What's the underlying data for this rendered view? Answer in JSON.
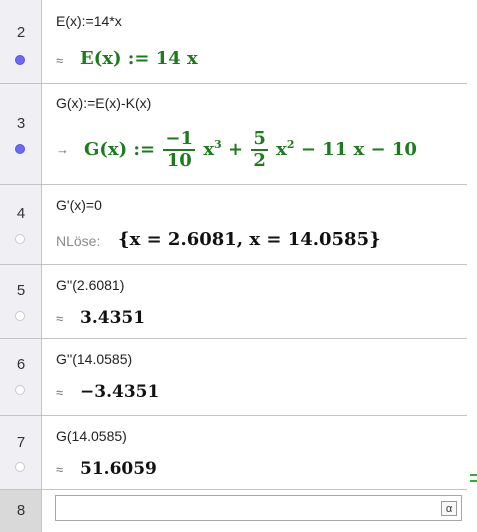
{
  "rows": [
    {
      "num": "2",
      "input": "E(x):=14*x",
      "symbol": "≈",
      "output": "E(x) := 14 x"
    },
    {
      "num": "3",
      "input": "G(x):=E(x)-K(x)",
      "symbol": "→",
      "output": {
        "lhs": "G(x) :=",
        "f1_num": "−1",
        "f1_den": "10",
        "x3": "x",
        "exp3": "3",
        "plus": "+",
        "f2_num": "5",
        "f2_den": "2",
        "x2": "x",
        "exp2": "2",
        "rest": "− 11 x − 10"
      }
    },
    {
      "num": "4",
      "input": "G'(x)=0",
      "symbol": "NLöse:",
      "output": "{x = 2.6081, x = 14.0585}"
    },
    {
      "num": "5",
      "input": "G''(2.6081)",
      "symbol": "≈",
      "output": "3.4351"
    },
    {
      "num": "6",
      "input": "G''(14.0585)",
      "symbol": "≈",
      "output": "−3.4351"
    },
    {
      "num": "7",
      "input": "G(14.0585)",
      "symbol": "≈",
      "output": "51.6059"
    },
    {
      "num": "8",
      "input_value": "",
      "alpha": "α"
    }
  ],
  "colors": {
    "dot_active": "#6a6af5",
    "output_green": "#1e7a1e",
    "gutter": "#f0f0f4"
  }
}
